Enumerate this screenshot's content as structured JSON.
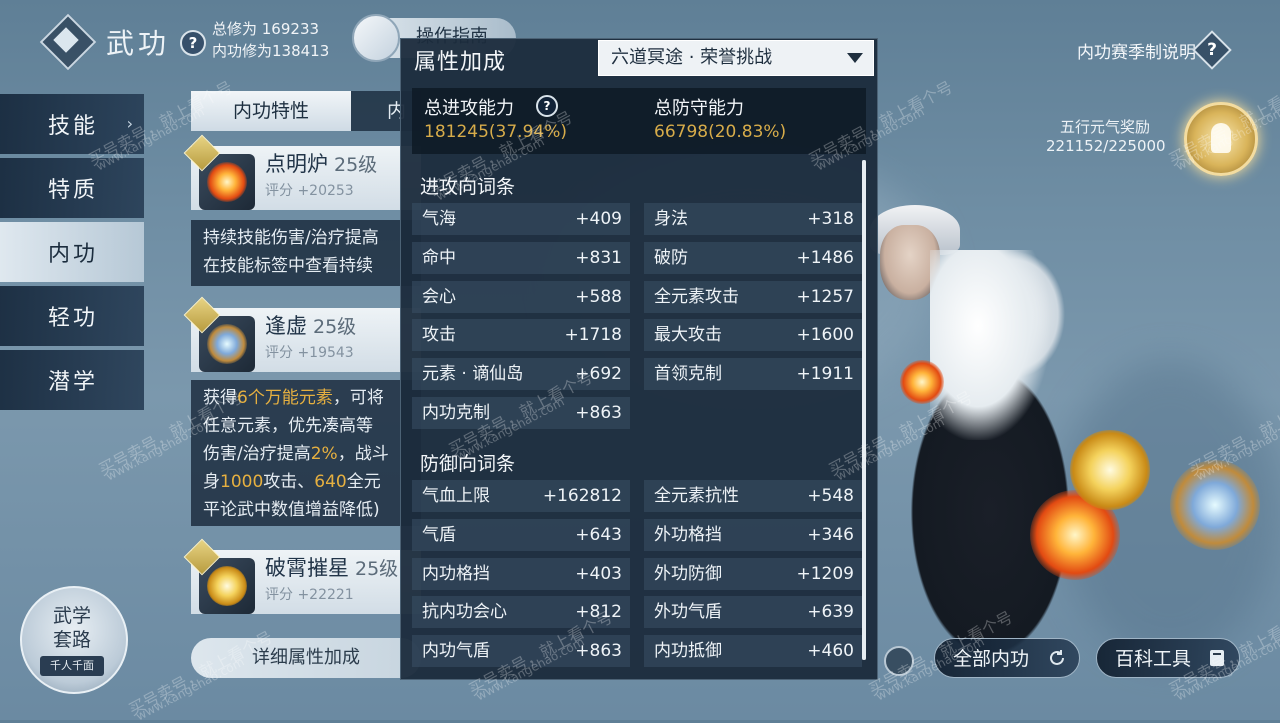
{
  "header": {
    "title": "武功",
    "total_cultivation": "总修为 169233",
    "inner_cultivation": "内功修为138413",
    "guide_label": "操作指南",
    "season_rules": "内功赛季制说明"
  },
  "sidebar": {
    "items": [
      {
        "label": "技能"
      },
      {
        "label": "特质"
      },
      {
        "label": "内功"
      },
      {
        "label": "轻功"
      },
      {
        "label": "潜学"
      }
    ],
    "active_index": 2
  },
  "list": {
    "tab_active": "内功特性",
    "tab_inactive": "内",
    "cards": [
      {
        "name": "点明炉",
        "level": "25级",
        "score": "评分 +20253",
        "desc": [
          "持续技能伤害/治疗提高",
          "在技能标签中查看持续"
        ]
      },
      {
        "name": "逢虚",
        "level": "25级",
        "score": "评分 +19543",
        "desc_parts": [
          [
            {
              "t": "获得"
            },
            {
              "t": "6个万能元素",
              "hl": true
            },
            {
              "t": "，可将"
            }
          ],
          [
            {
              "t": "任意元素，优先凑高等"
            }
          ],
          [
            {
              "t": "伤害/治疗提高"
            },
            {
              "t": "2%",
              "hl": true
            },
            {
              "t": "，战斗"
            }
          ],
          [
            {
              "t": "身"
            },
            {
              "t": "1000",
              "hl": true
            },
            {
              "t": "攻击、"
            },
            {
              "t": "640",
              "hl": true
            },
            {
              "t": "全元"
            }
          ],
          [
            {
              "t": "平论武中数值增益降低)"
            }
          ]
        ]
      },
      {
        "name": "破霄摧星",
        "level": "25级",
        "score": "评分 +22221"
      }
    ],
    "detail_button": "详细属性加成"
  },
  "wuxue": {
    "title": "武学\n套路",
    "subtitle": "千人千面"
  },
  "reward": {
    "label": "五行元气奖励",
    "value": "221152/225000"
  },
  "bottom_buttons": {
    "all_inner": "全部内功",
    "encyclopedia": "百科工具"
  },
  "popup": {
    "title": "属性加成",
    "dropdown_value": "六道冥途 · 荣誉挑战",
    "total_attack_label": "总进攻能力",
    "total_attack_value": "181245(37.94%)",
    "total_defense_label": "总防守能力",
    "total_defense_value": "66798(20.83%)",
    "attack_section": "进攻向词条",
    "attack_rows": [
      [
        "气海",
        "+409",
        "身法",
        "+318"
      ],
      [
        "命中",
        "+831",
        "破防",
        "+1486"
      ],
      [
        "会心",
        "+588",
        "全元素攻击",
        "+1257"
      ],
      [
        "攻击",
        "+1718",
        "最大攻击",
        "+1600"
      ],
      [
        "元素 · 谪仙岛",
        "+692",
        "首领克制",
        "+1911"
      ],
      [
        "内功克制",
        "+863",
        "",
        ""
      ]
    ],
    "defense_section": "防御向词条",
    "defense_rows": [
      [
        "气血上限",
        "+162812",
        "全元素抗性",
        "+548"
      ],
      [
        "气盾",
        "+643",
        "外功格挡",
        "+346"
      ],
      [
        "内功格挡",
        "+403",
        "外功防御",
        "+1209"
      ],
      [
        "抗内功会心",
        "+812",
        "外功气盾",
        "+639"
      ],
      [
        "内功气盾",
        "+863",
        "内功抵御",
        "+460"
      ]
    ]
  },
  "watermark": {
    "line1": "买号卖号，就上看个号",
    "line2": "www.kangehao.com"
  },
  "colors": {
    "accent_gold": "#d7ac4a",
    "highlight": "#e6b040",
    "panel_bg": "#1b2b3c"
  }
}
